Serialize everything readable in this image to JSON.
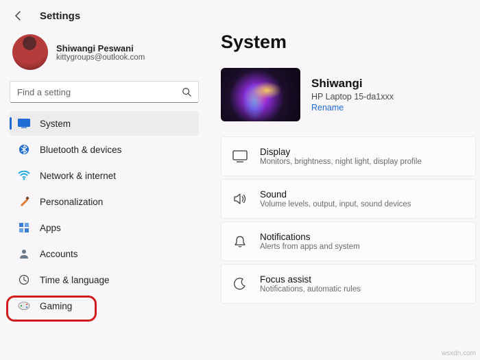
{
  "header": {
    "title": "Settings"
  },
  "profile": {
    "name": "Shiwangi Peswani",
    "email": "kittygroups@outlook.com"
  },
  "search": {
    "placeholder": "Find a setting"
  },
  "nav": {
    "items": [
      {
        "label": "System"
      },
      {
        "label": "Bluetooth & devices"
      },
      {
        "label": "Network & internet"
      },
      {
        "label": "Personalization"
      },
      {
        "label": "Apps"
      },
      {
        "label": "Accounts"
      },
      {
        "label": "Time & language"
      },
      {
        "label": "Gaming"
      }
    ]
  },
  "main": {
    "title": "System",
    "device": {
      "name": "Shiwangi",
      "model": "HP Laptop 15-da1xxx",
      "rename": "Rename"
    },
    "cards": [
      {
        "title": "Display",
        "sub": "Monitors, brightness, night light, display profile"
      },
      {
        "title": "Sound",
        "sub": "Volume levels, output, input, sound devices"
      },
      {
        "title": "Notifications",
        "sub": "Alerts from apps and system"
      },
      {
        "title": "Focus assist",
        "sub": "Notifications, automatic rules"
      }
    ]
  },
  "watermark": "wsxdn.com"
}
